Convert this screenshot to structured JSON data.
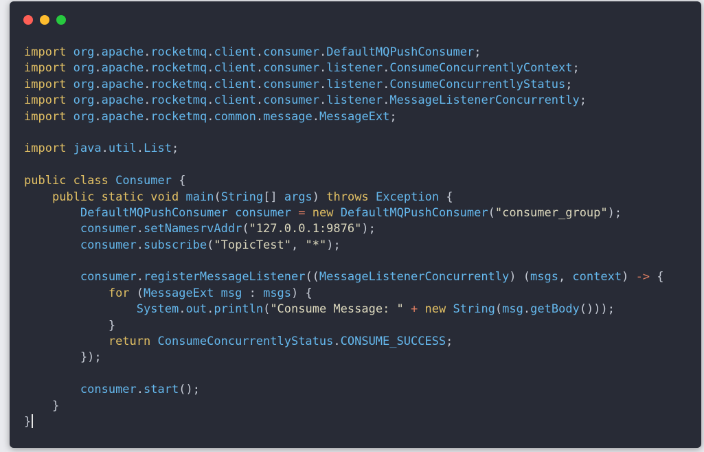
{
  "window": {
    "buttons": {
      "close": "close",
      "minimize": "minimize",
      "maximize": "maximize"
    }
  },
  "colors": {
    "background": "#282b36",
    "keyword": "#e2c064",
    "identifier": "#65b8ed",
    "string": "#dcd8bd",
    "punctuation": "#c6cbd5",
    "operator": "#e07f63"
  },
  "code": {
    "language": "java",
    "lines": [
      [
        [
          "kw",
          "import"
        ],
        [
          "p",
          " "
        ],
        [
          "id",
          "org"
        ],
        [
          "p",
          "."
        ],
        [
          "id",
          "apache"
        ],
        [
          "p",
          "."
        ],
        [
          "id",
          "rocketmq"
        ],
        [
          "p",
          "."
        ],
        [
          "id",
          "client"
        ],
        [
          "p",
          "."
        ],
        [
          "id",
          "consumer"
        ],
        [
          "p",
          "."
        ],
        [
          "id",
          "DefaultMQPushConsumer"
        ],
        [
          "p",
          ";"
        ]
      ],
      [
        [
          "kw",
          "import"
        ],
        [
          "p",
          " "
        ],
        [
          "id",
          "org"
        ],
        [
          "p",
          "."
        ],
        [
          "id",
          "apache"
        ],
        [
          "p",
          "."
        ],
        [
          "id",
          "rocketmq"
        ],
        [
          "p",
          "."
        ],
        [
          "id",
          "client"
        ],
        [
          "p",
          "."
        ],
        [
          "id",
          "consumer"
        ],
        [
          "p",
          "."
        ],
        [
          "id",
          "listener"
        ],
        [
          "p",
          "."
        ],
        [
          "id",
          "ConsumeConcurrentlyContext"
        ],
        [
          "p",
          ";"
        ]
      ],
      [
        [
          "kw",
          "import"
        ],
        [
          "p",
          " "
        ],
        [
          "id",
          "org"
        ],
        [
          "p",
          "."
        ],
        [
          "id",
          "apache"
        ],
        [
          "p",
          "."
        ],
        [
          "id",
          "rocketmq"
        ],
        [
          "p",
          "."
        ],
        [
          "id",
          "client"
        ],
        [
          "p",
          "."
        ],
        [
          "id",
          "consumer"
        ],
        [
          "p",
          "."
        ],
        [
          "id",
          "listener"
        ],
        [
          "p",
          "."
        ],
        [
          "id",
          "ConsumeConcurrentlyStatus"
        ],
        [
          "p",
          ";"
        ]
      ],
      [
        [
          "kw",
          "import"
        ],
        [
          "p",
          " "
        ],
        [
          "id",
          "org"
        ],
        [
          "p",
          "."
        ],
        [
          "id",
          "apache"
        ],
        [
          "p",
          "."
        ],
        [
          "id",
          "rocketmq"
        ],
        [
          "p",
          "."
        ],
        [
          "id",
          "client"
        ],
        [
          "p",
          "."
        ],
        [
          "id",
          "consumer"
        ],
        [
          "p",
          "."
        ],
        [
          "id",
          "listener"
        ],
        [
          "p",
          "."
        ],
        [
          "id",
          "MessageListenerConcurrently"
        ],
        [
          "p",
          ";"
        ]
      ],
      [
        [
          "kw",
          "import"
        ],
        [
          "p",
          " "
        ],
        [
          "id",
          "org"
        ],
        [
          "p",
          "."
        ],
        [
          "id",
          "apache"
        ],
        [
          "p",
          "."
        ],
        [
          "id",
          "rocketmq"
        ],
        [
          "p",
          "."
        ],
        [
          "id",
          "common"
        ],
        [
          "p",
          "."
        ],
        [
          "id",
          "message"
        ],
        [
          "p",
          "."
        ],
        [
          "id",
          "MessageExt"
        ],
        [
          "p",
          ";"
        ]
      ],
      [],
      [
        [
          "kw",
          "import"
        ],
        [
          "p",
          " "
        ],
        [
          "id",
          "java"
        ],
        [
          "p",
          "."
        ],
        [
          "id",
          "util"
        ],
        [
          "p",
          "."
        ],
        [
          "id",
          "List"
        ],
        [
          "p",
          ";"
        ]
      ],
      [],
      [
        [
          "kw",
          "public"
        ],
        [
          "p",
          " "
        ],
        [
          "kw",
          "class"
        ],
        [
          "p",
          " "
        ],
        [
          "id",
          "Consumer"
        ],
        [
          "p",
          " {"
        ]
      ],
      [
        [
          "p",
          "    "
        ],
        [
          "kw",
          "public"
        ],
        [
          "p",
          " "
        ],
        [
          "kw",
          "static"
        ],
        [
          "p",
          " "
        ],
        [
          "kw",
          "void"
        ],
        [
          "p",
          " "
        ],
        [
          "id",
          "main"
        ],
        [
          "p",
          "("
        ],
        [
          "id",
          "String"
        ],
        [
          "p",
          "[] "
        ],
        [
          "id",
          "args"
        ],
        [
          "p",
          ") "
        ],
        [
          "kw",
          "throws"
        ],
        [
          "p",
          " "
        ],
        [
          "id",
          "Exception"
        ],
        [
          "p",
          " {"
        ]
      ],
      [
        [
          "p",
          "        "
        ],
        [
          "id",
          "DefaultMQPushConsumer"
        ],
        [
          "p",
          " "
        ],
        [
          "id",
          "consumer"
        ],
        [
          "p",
          " "
        ],
        [
          "op",
          "="
        ],
        [
          "p",
          " "
        ],
        [
          "kw",
          "new"
        ],
        [
          "p",
          " "
        ],
        [
          "id",
          "DefaultMQPushConsumer"
        ],
        [
          "p",
          "("
        ],
        [
          "str",
          "\"consumer_group\""
        ],
        [
          "p",
          ");"
        ]
      ],
      [
        [
          "p",
          "        "
        ],
        [
          "id",
          "consumer"
        ],
        [
          "p",
          "."
        ],
        [
          "id",
          "setNamesrvAddr"
        ],
        [
          "p",
          "("
        ],
        [
          "str",
          "\"127.0.0.1:9876\""
        ],
        [
          "p",
          ");"
        ]
      ],
      [
        [
          "p",
          "        "
        ],
        [
          "id",
          "consumer"
        ],
        [
          "p",
          "."
        ],
        [
          "id",
          "subscribe"
        ],
        [
          "p",
          "("
        ],
        [
          "str",
          "\"TopicTest\""
        ],
        [
          "p",
          ", "
        ],
        [
          "str",
          "\"*\""
        ],
        [
          "p",
          ");"
        ]
      ],
      [],
      [
        [
          "p",
          "        "
        ],
        [
          "id",
          "consumer"
        ],
        [
          "p",
          "."
        ],
        [
          "id",
          "registerMessageListener"
        ],
        [
          "p",
          "(("
        ],
        [
          "id",
          "MessageListenerConcurrently"
        ],
        [
          "p",
          ") ("
        ],
        [
          "id",
          "msgs"
        ],
        [
          "p",
          ", "
        ],
        [
          "id",
          "context"
        ],
        [
          "p",
          ") "
        ],
        [
          "op",
          "->"
        ],
        [
          "p",
          " {"
        ]
      ],
      [
        [
          "p",
          "            "
        ],
        [
          "kw",
          "for"
        ],
        [
          "p",
          " ("
        ],
        [
          "id",
          "MessageExt"
        ],
        [
          "p",
          " "
        ],
        [
          "id",
          "msg"
        ],
        [
          "p",
          " : "
        ],
        [
          "id",
          "msgs"
        ],
        [
          "p",
          ") {"
        ]
      ],
      [
        [
          "p",
          "                "
        ],
        [
          "id",
          "System"
        ],
        [
          "p",
          "."
        ],
        [
          "id",
          "out"
        ],
        [
          "p",
          "."
        ],
        [
          "id",
          "println"
        ],
        [
          "p",
          "("
        ],
        [
          "str",
          "\"Consume Message: \""
        ],
        [
          "p",
          " "
        ],
        [
          "op",
          "+"
        ],
        [
          "p",
          " "
        ],
        [
          "kw",
          "new"
        ],
        [
          "p",
          " "
        ],
        [
          "id",
          "String"
        ],
        [
          "p",
          "("
        ],
        [
          "id",
          "msg"
        ],
        [
          "p",
          "."
        ],
        [
          "id",
          "getBody"
        ],
        [
          "p",
          "()));"
        ]
      ],
      [
        [
          "p",
          "            }"
        ]
      ],
      [
        [
          "p",
          "            "
        ],
        [
          "kw",
          "return"
        ],
        [
          "p",
          " "
        ],
        [
          "id",
          "ConsumeConcurrentlyStatus"
        ],
        [
          "p",
          "."
        ],
        [
          "id",
          "CONSUME_SUCCESS"
        ],
        [
          "p",
          ";"
        ]
      ],
      [
        [
          "p",
          "        });"
        ]
      ],
      [],
      [
        [
          "p",
          "        "
        ],
        [
          "id",
          "consumer"
        ],
        [
          "p",
          "."
        ],
        [
          "id",
          "start"
        ],
        [
          "p",
          "();"
        ]
      ],
      [
        [
          "p",
          "    }"
        ]
      ],
      [
        [
          "p",
          "}"
        ]
      ]
    ]
  }
}
